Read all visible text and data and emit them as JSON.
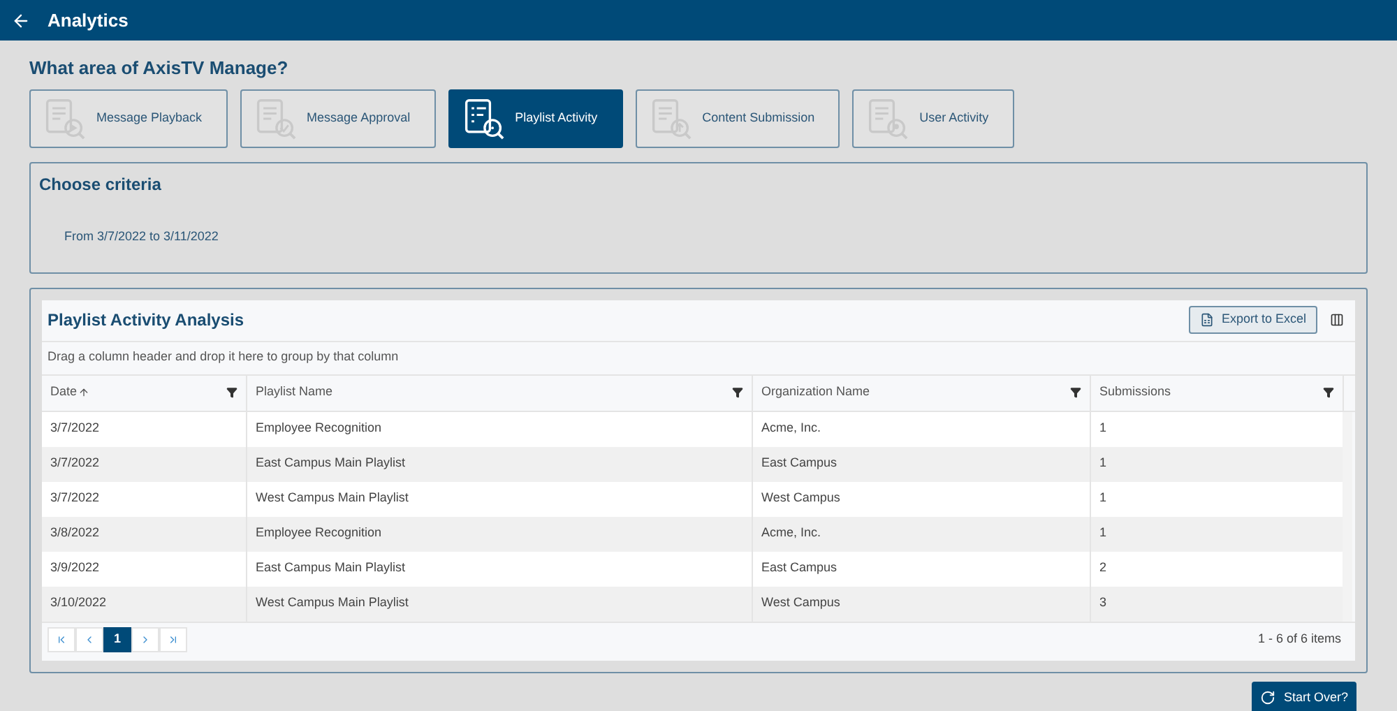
{
  "header": {
    "title": "Analytics"
  },
  "area_prompt": "What area of AxisTV Manage?",
  "areas": [
    {
      "label": "Message Playback",
      "kind": "playback",
      "selected": false
    },
    {
      "label": "Message Approval",
      "kind": "approval",
      "selected": false
    },
    {
      "label": "Playlist Activity",
      "kind": "playlist",
      "selected": true
    },
    {
      "label": "Content Submission",
      "kind": "submission",
      "selected": false
    },
    {
      "label": "User Activity",
      "kind": "user",
      "selected": false
    }
  ],
  "criteria": {
    "title": "Choose criteria",
    "text": "From 3/7/2022 to 3/11/2022"
  },
  "grid": {
    "title": "Playlist Activity Analysis",
    "export_button": "Export to Excel",
    "group_hint": "Drag a column header and drop it here to group by that column",
    "columns": [
      {
        "label": "Date",
        "sorted": true
      },
      {
        "label": "Playlist Name",
        "sorted": false
      },
      {
        "label": "Organization Name",
        "sorted": false
      },
      {
        "label": "Submissions",
        "sorted": false
      }
    ],
    "rows": [
      [
        "3/7/2022",
        "Employee Recognition",
        "Acme, Inc.",
        "1"
      ],
      [
        "3/7/2022",
        "East Campus Main Playlist",
        "East Campus",
        "1"
      ],
      [
        "3/7/2022",
        "West Campus Main Playlist",
        "West Campus",
        "1"
      ],
      [
        "3/8/2022",
        "Employee Recognition",
        "Acme, Inc.",
        "1"
      ],
      [
        "3/9/2022",
        "East Campus Main Playlist",
        "East Campus",
        "2"
      ],
      [
        "3/10/2022",
        "West Campus Main Playlist",
        "West Campus",
        "3"
      ]
    ],
    "pages": [
      {
        "label": "1",
        "selected": true
      }
    ],
    "summary": "1 - 6 of 6 items"
  },
  "start_over_button": "Start Over?"
}
